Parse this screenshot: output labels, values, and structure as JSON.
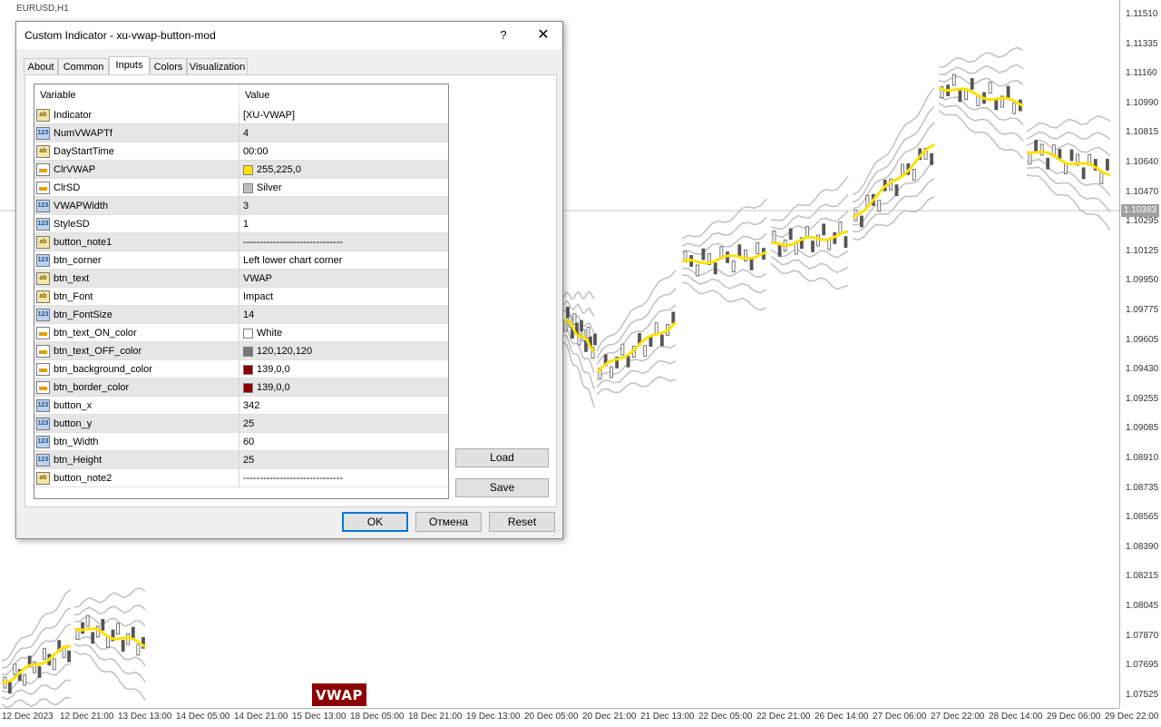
{
  "chart": {
    "symbol_label": "EURUSD,H1",
    "current_price": "1.10383",
    "price_labels": [
      "1.11510",
      "1.11335",
      "1.11160",
      "1.10990",
      "1.10815",
      "1.10640",
      "1.10470",
      "1.10295",
      "1.10125",
      "1.09950",
      "1.09775",
      "1.09605",
      "1.09430",
      "1.09255",
      "1.09085",
      "1.08910",
      "1.08735",
      "1.08565",
      "1.08390",
      "1.08215",
      "1.08045",
      "1.07870",
      "1.07695",
      "1.07525"
    ],
    "time_labels": [
      "12 Dec 2023",
      "12 Dec 21:00",
      "13 Dec 13:00",
      "14 Dec 05:00",
      "14 Dec 21:00",
      "15 Dec 13:00",
      "18 Dec 05:00",
      "18 Dec 21:00",
      "19 Dec 13:00",
      "20 Dec 05:00",
      "20 Dec 21:00",
      "21 Dec 13:00",
      "22 Dec 05:00",
      "22 Dec 21:00",
      "26 Dec 14:00",
      "27 Dec 06:00",
      "27 Dec 22:00",
      "28 Dec 14:00",
      "29 Dec 06:00",
      "29 Dec 22:00"
    ],
    "vwap_button": "VWAP",
    "vwap_color": "#ffe100",
    "sd_color": "#c0c0c0"
  },
  "dialog": {
    "title": "Custom Indicator - xu-vwap-button-mod",
    "help": "?",
    "close": "✕",
    "tabs": [
      "About",
      "Common",
      "Inputs",
      "Colors",
      "Visualization"
    ],
    "active_tab": "Inputs",
    "columns": {
      "variable": "Variable",
      "value": "Value"
    },
    "params": [
      {
        "type": "ab",
        "name": "Indicator",
        "value": "[XU-VWAP]"
      },
      {
        "type": "num",
        "name": "NumVWAPTf",
        "value": "4"
      },
      {
        "type": "ab",
        "name": "DayStartTime",
        "value": "00:00"
      },
      {
        "type": "clr",
        "name": "ClrVWAP",
        "value": "255,225,0",
        "color": "#ffe100"
      },
      {
        "type": "clr",
        "name": "ClrSD",
        "value": "Silver",
        "color": "#c0c0c0"
      },
      {
        "type": "num",
        "name": "VWAPWidth",
        "value": "3"
      },
      {
        "type": "num",
        "name": "StyleSD",
        "value": "1"
      },
      {
        "type": "ab",
        "name": "button_note1",
        "value": "------------------------------"
      },
      {
        "type": "num",
        "name": "btn_corner",
        "value": "Left lower chart corner"
      },
      {
        "type": "ab",
        "name": "btn_text",
        "value": "VWAP"
      },
      {
        "type": "ab",
        "name": "btn_Font",
        "value": "Impact"
      },
      {
        "type": "num",
        "name": "btn_FontSize",
        "value": "14"
      },
      {
        "type": "clr",
        "name": "btn_text_ON_color",
        "value": "White",
        "color": "#ffffff"
      },
      {
        "type": "clr",
        "name": "btn_text_OFF_color",
        "value": "120,120,120",
        "color": "#787878"
      },
      {
        "type": "clr",
        "name": "btn_background_color",
        "value": "139,0,0",
        "color": "#8b0000"
      },
      {
        "type": "clr",
        "name": "btn_border_color",
        "value": "139,0,0",
        "color": "#8b0000"
      },
      {
        "type": "num",
        "name": "button_x",
        "value": "342"
      },
      {
        "type": "num",
        "name": "button_y",
        "value": "25"
      },
      {
        "type": "num",
        "name": "btn_Width",
        "value": "60"
      },
      {
        "type": "num",
        "name": "btn_Height",
        "value": "25"
      },
      {
        "type": "ab",
        "name": "button_note2",
        "value": "------------------------------"
      }
    ],
    "load": "Load",
    "save": "Save",
    "ok": "OK",
    "cancel": "Отмена",
    "reset": "Reset"
  }
}
